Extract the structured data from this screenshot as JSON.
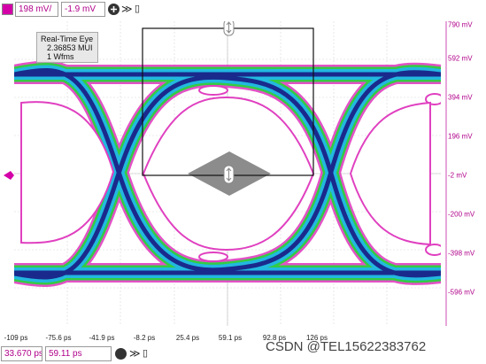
{
  "top_toolbar": {
    "scale_value": "198 mV/",
    "offset_value": "-1.9 mV",
    "expand_label": "≫",
    "stats_label": "▯"
  },
  "bottom_toolbar": {
    "scale_value": "33.670 ps/",
    "offset_value": "59.11 ps",
    "expand_label": "≫",
    "stats_label": "▯"
  },
  "infobox": {
    "line1": "Real-Time Eye",
    "line2": "2.36853 MUI",
    "line3": "1 Wfms"
  },
  "x_ticks": [
    "-109 ps",
    "-75.6 ps",
    "-41.9 ps",
    "-8.2 ps",
    "25.4 ps",
    "59.1 ps",
    "92.8 ps",
    "126 ps"
  ],
  "y_ticks": [
    "790 mV",
    "592 mV",
    "394 mV",
    "196 mV",
    "-2 mV",
    "-200 mV",
    "-398 mV",
    "-596 mV"
  ],
  "watermark": "CSDN @TEL15622383762",
  "colors": {
    "accent": "#b0008a",
    "mask": "#8c8c8c",
    "eye_core": "#1a2a8c",
    "eye_outer": "#e040c0"
  }
}
